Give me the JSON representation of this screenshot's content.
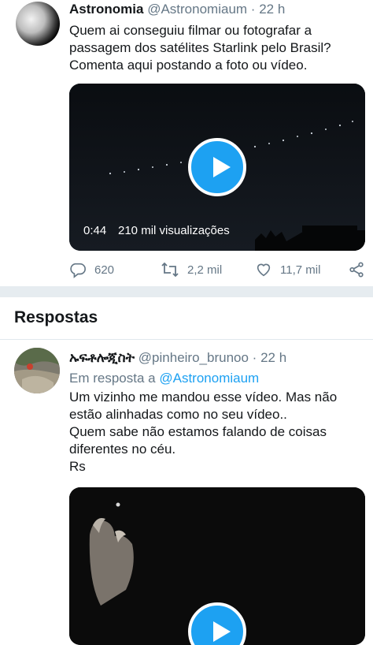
{
  "main_tweet": {
    "name": "Astronomia",
    "handle": "@Astronomiaum",
    "separator": "·",
    "time": "22 h",
    "text_lines": [
      "Quem ai conseguiu filmar ou fotografar a",
      "passagem dos satélites Starlink pelo Brasil?",
      "Comenta aqui postando a foto ou vídeo."
    ],
    "video": {
      "duration": "0:44",
      "views": "210 mil visualizações"
    },
    "actions": {
      "replies": "620",
      "retweets": "2,2 mil",
      "likes": "11,7 mil"
    }
  },
  "section": {
    "title": "Respostas"
  },
  "reply_tweet": {
    "name": "ኡፍቶሎጂስት",
    "handle": "@pinheiro_brunoo",
    "separator": "·",
    "time": "22 h",
    "in_reply_prefix": "Em resposta a",
    "in_reply_handle": "@Astronomiaum",
    "text_lines": [
      "Um vizinho me mandou esse vídeo. Mas não",
      "estão alinhadas como no seu vídeo..",
      "Quem sabe não estamos falando de coisas",
      "diferentes no céu.",
      "Rs"
    ]
  },
  "colors": {
    "accent": "#1da1f2",
    "muted": "#657786",
    "text": "#14171a",
    "separator": "#e6ecf0"
  }
}
